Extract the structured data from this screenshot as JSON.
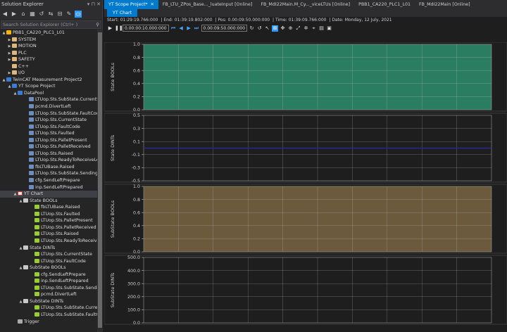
{
  "solution_explorer": {
    "title": "Solution Explorer",
    "search_placeholder": "Search Solution Explorer (Ctrl+ )",
    "tree": [
      {
        "label": "PBB1_CA220_PLC1_L01",
        "indent": 0,
        "arrow": "▲",
        "icon": "twin",
        "selected": false
      },
      {
        "label": "SYSTEM",
        "indent": 1,
        "arrow": "▶",
        "icon": "folder"
      },
      {
        "label": "MOTION",
        "indent": 1,
        "arrow": "▶",
        "icon": "folder"
      },
      {
        "label": "PLC",
        "indent": 1,
        "arrow": "▶",
        "icon": "folder"
      },
      {
        "label": "SAFETY",
        "indent": 1,
        "arrow": "▶",
        "icon": "folder"
      },
      {
        "label": "C++",
        "indent": 1,
        "arrow": "",
        "icon": "folder"
      },
      {
        "label": "I/O",
        "indent": 1,
        "arrow": "▶",
        "icon": "folder"
      },
      {
        "label": "TwinCAT Measurement Project2",
        "indent": 0,
        "arrow": "▲",
        "icon": "proj"
      },
      {
        "label": "YT Scope Project",
        "indent": 1,
        "arrow": "▲",
        "icon": "proj"
      },
      {
        "label": "DataPool",
        "indent": 2,
        "arrow": "▲",
        "icon": "proj"
      },
      {
        "label": "LTUop.Sts.SubState.CurrentSt",
        "indent": 4,
        "arrow": "",
        "icon": "var"
      },
      {
        "label": "pcmd.DivertLeft",
        "indent": 4,
        "arrow": "",
        "icon": "var"
      },
      {
        "label": "LTUop.Sts.SubState.FaultCod",
        "indent": 4,
        "arrow": "",
        "icon": "var"
      },
      {
        "label": "LTUop.Sts.CurrentState",
        "indent": 4,
        "arrow": "",
        "icon": "var"
      },
      {
        "label": "LTUop.Sts.FaultCode",
        "indent": 4,
        "arrow": "",
        "icon": "var"
      },
      {
        "label": "LTUop.Sts.Faulted",
        "indent": 4,
        "arrow": "",
        "icon": "var"
      },
      {
        "label": "LTUop.Sts.PalletPresent",
        "indent": 4,
        "arrow": "",
        "icon": "var"
      },
      {
        "label": "LTUop.Sts.PalletReceived",
        "indent": 4,
        "arrow": "",
        "icon": "var"
      },
      {
        "label": "LTUop.Sts.Raised",
        "indent": 4,
        "arrow": "",
        "icon": "var"
      },
      {
        "label": "LTUop.Sts.ReadyToReceiveLe",
        "indent": 4,
        "arrow": "",
        "icon": "var"
      },
      {
        "label": "fbLTUBase.Raised",
        "indent": 4,
        "arrow": "",
        "icon": "var"
      },
      {
        "label": "LTUop.Sts.SubState.Sending",
        "indent": 4,
        "arrow": "",
        "icon": "var"
      },
      {
        "label": "cfg.SendLeftPrepare",
        "indent": 4,
        "arrow": "",
        "icon": "var"
      },
      {
        "label": "inp.SendLeftPrepared",
        "indent": 4,
        "arrow": "",
        "icon": "var"
      },
      {
        "label": "YT Chart",
        "indent": 2,
        "arrow": "▲",
        "icon": "chart",
        "selected": true
      },
      {
        "label": "State BOOLs",
        "indent": 3,
        "arrow": "▲",
        "icon": "group"
      },
      {
        "label": "fbLTUBase.Raised",
        "indent": 5,
        "arrow": "",
        "icon": "lamp"
      },
      {
        "label": "LTUop.Sts.Faulted",
        "indent": 5,
        "arrow": "",
        "icon": "lamp"
      },
      {
        "label": "LTUop.Sts.PalletPresent",
        "indent": 5,
        "arrow": "",
        "icon": "lamp"
      },
      {
        "label": "LTUop.Sts.PalletReceived",
        "indent": 5,
        "arrow": "",
        "icon": "lamp"
      },
      {
        "label": "LTUop.Sts.Raised",
        "indent": 5,
        "arrow": "",
        "icon": "lamp"
      },
      {
        "label": "LTUop.Sts.ReadyToReceiv",
        "indent": 5,
        "arrow": "",
        "icon": "lamp"
      },
      {
        "label": "State DINTs",
        "indent": 3,
        "arrow": "▲",
        "icon": "group"
      },
      {
        "label": "LTUop.Sts.CurrentState",
        "indent": 5,
        "arrow": "",
        "icon": "lamp"
      },
      {
        "label": "LTUop.Sts.FaultCode",
        "indent": 5,
        "arrow": "",
        "icon": "lamp"
      },
      {
        "label": "SubState BOOLs",
        "indent": 3,
        "arrow": "▲",
        "icon": "group"
      },
      {
        "label": "cfg.SendLeftPrepare",
        "indent": 5,
        "arrow": "",
        "icon": "lamp"
      },
      {
        "label": "inp.SendLeftPrepared",
        "indent": 5,
        "arrow": "",
        "icon": "lamp"
      },
      {
        "label": "LTUop.Sts.SubState.Sendi",
        "indent": 5,
        "arrow": "",
        "icon": "lamp"
      },
      {
        "label": "pcmd.DivertLeft",
        "indent": 5,
        "arrow": "",
        "icon": "lamp"
      },
      {
        "label": "SubState DINTs",
        "indent": 3,
        "arrow": "▲",
        "icon": "group"
      },
      {
        "label": "LTUop.Sts.SubState.Currer",
        "indent": 5,
        "arrow": "",
        "icon": "lamp"
      },
      {
        "label": "LTUop.Sts.SubState.FaultC",
        "indent": 5,
        "arrow": "",
        "icon": "lamp"
      },
      {
        "label": "Trigger",
        "indent": 2,
        "arrow": "",
        "icon": "trig"
      }
    ]
  },
  "doc_tabs": [
    {
      "label": "YT Scope Project*",
      "active": true,
      "close": "✕"
    },
    {
      "label": "FB_LTU_ZPos_Base..._luateInput [Online]",
      "active": false
    },
    {
      "label": "FB_MdI22Main.M_Cy..._viceLTUs [Online]",
      "active": false
    },
    {
      "label": "PBB1_CA220_PLC1_L01",
      "active": false
    },
    {
      "label": "FB_MdI22Main [Online]",
      "active": false
    }
  ],
  "scope": {
    "subtab": "YT Chart",
    "info": {
      "start_label": "Start:",
      "start": "01:29:19.766:000",
      "end_label": "| End:",
      "end": "01:39:19.802:000",
      "pos_label": "| Pos:",
      "pos": "0.00:09:50.000:000",
      "time_label": "| Time:",
      "time": "01:39:09.766:000",
      "date_label": "| Date:",
      "date": "Monday, 12 July, 2021"
    },
    "time_box_1": "0.00:00:10.000:000",
    "time_box_2": "0.00:09:50.000:000"
  },
  "colors": {
    "green_fill": "#2b7d62",
    "orange_fill": "#6b5a3c",
    "dark_fill": "#1e1e1e",
    "grid": "#c8c8c8",
    "series_blue": "#2a2aa8"
  },
  "chart_data": [
    {
      "type": "line",
      "ylabel": "State BOOLs",
      "yticks": [
        "1.0",
        "0.8",
        "0.6",
        "0.4",
        "0.2",
        "0.0"
      ],
      "ylim": [
        0,
        1
      ],
      "fill": "green",
      "grid": true,
      "series": []
    },
    {
      "type": "line",
      "ylabel": "State DINTs",
      "yticks": [
        "0.5",
        "0.3",
        "0.1",
        "-0.1",
        "-0.3",
        "-0.5"
      ],
      "ylim": [
        -0.5,
        0.5
      ],
      "fill": "dark",
      "grid": true,
      "series": [
        {
          "values_constant": 0.0,
          "color": "series_blue"
        }
      ]
    },
    {
      "type": "line",
      "ylabel": "SubState BOOLs",
      "yticks": [
        "1.0",
        "0.8",
        "0.6",
        "0.4",
        "0.2",
        "0.0"
      ],
      "ylim": [
        0,
        1
      ],
      "fill": "orange",
      "grid": true,
      "series": []
    },
    {
      "type": "line",
      "ylabel": "SubState DINTs",
      "yticks": [
        "500.0",
        "400.0",
        "300.0",
        "200.0",
        "100.0",
        "0.0"
      ],
      "ylim": [
        0,
        500
      ],
      "fill": "dark",
      "grid": true,
      "series": []
    }
  ]
}
